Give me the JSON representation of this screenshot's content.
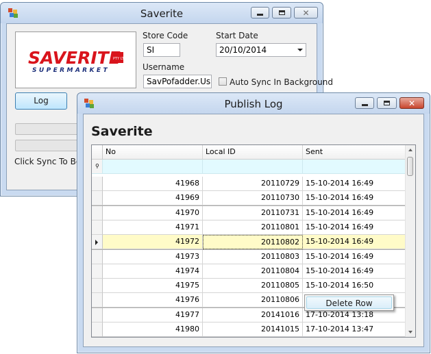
{
  "main_window": {
    "title": "Saverite",
    "logo": {
      "brand": "SAVERITE",
      "sub": "SUPERMARKET",
      "badge": "PTY LTD"
    },
    "store_code": {
      "label": "Store Code",
      "value": "SI"
    },
    "start_date": {
      "label": "Start Date",
      "value": "20/10/2014"
    },
    "username": {
      "label": "Username",
      "value": "SavPofadder.Usr"
    },
    "auto_sync": {
      "label": "Auto Sync In Background",
      "checked": false
    },
    "log_button": "Log",
    "status_text": "Click Sync To Begin",
    "progress_1": 0.0,
    "progress_2": 0.0
  },
  "log_window": {
    "title": "Publish Log",
    "heading": "Saverite",
    "columns": [
      "No",
      "Local ID",
      "Sent"
    ],
    "rows": [
      {
        "no": "41968",
        "local_id": "20110729",
        "sent": "15-10-2014 16:49"
      },
      {
        "no": "41969",
        "local_id": "20110730",
        "sent": "15-10-2014 16:49"
      },
      {
        "no": "41970",
        "local_id": "20110731",
        "sent": "15-10-2014 16:49"
      },
      {
        "no": "41971",
        "local_id": "20110801",
        "sent": "15-10-2014 16:49"
      },
      {
        "no": "41972",
        "local_id": "20110802",
        "sent": "15-10-2014 16:49"
      },
      {
        "no": "41973",
        "local_id": "20110803",
        "sent": "15-10-2014 16:49"
      },
      {
        "no": "41974",
        "local_id": "20110804",
        "sent": "15-10-2014 16:49"
      },
      {
        "no": "41975",
        "local_id": "20110805",
        "sent": "15-10-2014 16:50"
      },
      {
        "no": "41976",
        "local_id": "20110806",
        "sent": "15-10-2014 16:50"
      },
      {
        "no": "41977",
        "local_id": "20141016",
        "sent": "17-10-2014 13:18"
      },
      {
        "no": "41980",
        "local_id": "20141015",
        "sent": "17-10-2014 13:47"
      }
    ],
    "selected_row": 4,
    "context_menu": {
      "item": "Delete Row"
    }
  },
  "icons": {
    "app": "app-icon",
    "minimize": "minimize-icon",
    "maximize": "maximize-icon",
    "close": "close-icon",
    "dropdown": "chevron-down-icon",
    "filter": "filter-icon",
    "row_pointer": "row-pointer-icon"
  },
  "colors": {
    "logo_red": "#d9141c",
    "logo_blue": "#1c2f7a",
    "selected_row": "#fffbc8",
    "filter_row": "#e2faff"
  }
}
